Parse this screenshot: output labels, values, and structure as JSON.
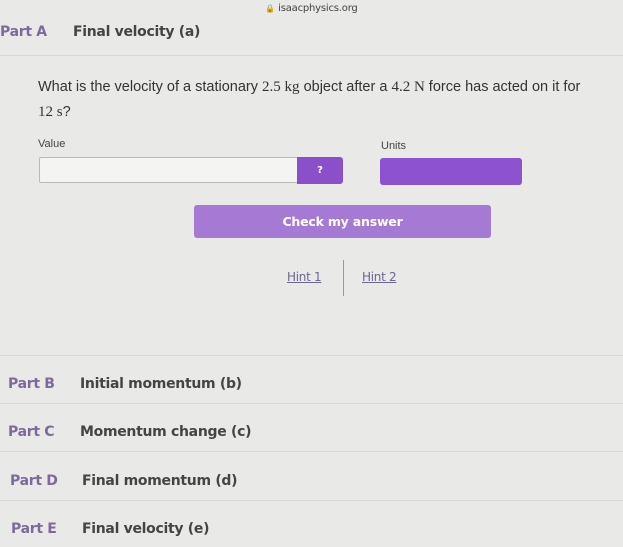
{
  "browser": {
    "url": "isaacphysics.org",
    "lock_icon": "lock-icon"
  },
  "partA": {
    "label": "Part A",
    "title": "Final velocity (a)",
    "question_prefix": "What is the velocity of a stationary ",
    "mass": "2.5 kg",
    "question_mid": " object after a ",
    "force": "4.2 N",
    "question_suffix": " force has acted on it for ",
    "time": "12 s",
    "question_end": "?",
    "value_label": "Value",
    "units_label": "Units",
    "value_input": "",
    "help_button_label": "?",
    "units_selected": "",
    "check_button_label": "Check my answer",
    "hints": [
      "Hint 1",
      "Hint 2"
    ]
  },
  "parts": [
    {
      "label": "Part B",
      "title": "Initial momentum (b)"
    },
    {
      "label": "Part C",
      "title": "Momentum change (c)"
    },
    {
      "label": "Part D",
      "title": "Final momentum (d)"
    },
    {
      "label": "Part E",
      "title": "Final velocity (e)"
    }
  ],
  "colors": {
    "accent": "#8a4fc9",
    "button_light": "#a57ad4",
    "part_label": "#7e6a9a",
    "background": "#e9e9e8"
  }
}
